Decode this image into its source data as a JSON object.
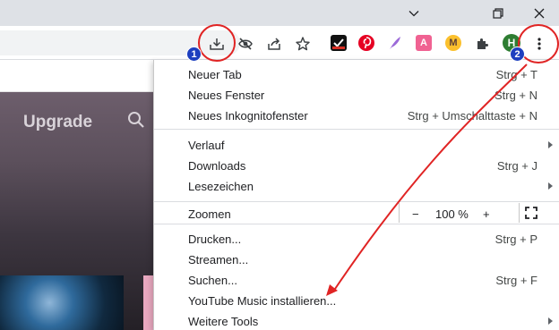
{
  "window": {
    "minimize_icon": "chevron-down-icon",
    "restore_icon": "restore-icon",
    "close_icon": "close-icon"
  },
  "toolbar": {
    "icons": [
      "download-icon",
      "eye-off-icon",
      "share-icon",
      "star-icon",
      "puzzle-extensions-icon",
      "more-vert-icon"
    ],
    "extensions": {
      "ext_m_label": "M",
      "ext_a_label": "A",
      "profile_label": "H"
    }
  },
  "page": {
    "upgrade_label": "Upgrade"
  },
  "menu": {
    "items": [
      {
        "label": "Neuer Tab",
        "shortcut": "Strg + T"
      },
      {
        "label": "Neues Fenster",
        "shortcut": "Strg + N"
      },
      {
        "label": "Neues Inkognitofenster",
        "shortcut": "Strg + Umschalttaste + N"
      },
      {
        "label": "Verlauf",
        "shortcut": ""
      },
      {
        "label": "Downloads",
        "shortcut": "Strg + J"
      },
      {
        "label": "Lesezeichen",
        "shortcut": ""
      },
      {
        "label": "Drucken...",
        "shortcut": "Strg + P"
      },
      {
        "label": "Streamen...",
        "shortcut": ""
      },
      {
        "label": "Suchen...",
        "shortcut": "Strg + F"
      },
      {
        "label": "YouTube Music installieren...",
        "shortcut": ""
      },
      {
        "label": "Weitere Tools",
        "shortcut": ""
      }
    ],
    "zoom": {
      "label": "Zoomen",
      "minus": "−",
      "value": "100 %",
      "plus": "+"
    }
  },
  "annotations": {
    "badge_1": "1",
    "badge_2": "2",
    "color": "#e02424",
    "badge_color": "#1d3fbf"
  }
}
